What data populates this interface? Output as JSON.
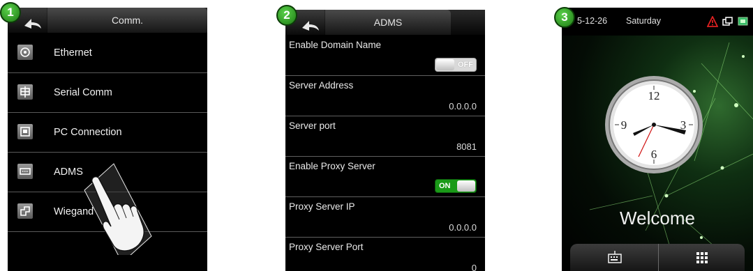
{
  "step_badges": [
    "1",
    "2",
    "3"
  ],
  "screen1": {
    "title": "Comm.",
    "items": [
      {
        "label": "Ethernet",
        "icon": "ethernet-icon"
      },
      {
        "label": "Serial Comm",
        "icon": "serial-comm-icon"
      },
      {
        "label": "PC Connection",
        "icon": "pc-connection-icon"
      },
      {
        "label": "ADMS",
        "icon": "adms-icon"
      },
      {
        "label": "Wiegand",
        "icon": "wiegand-icon"
      }
    ]
  },
  "screen2": {
    "title": "ADMS",
    "rows": [
      {
        "label": "Enable Domain Name",
        "toggle": "OFF"
      },
      {
        "label": "Server Address",
        "value": "0.0.0.0"
      },
      {
        "label": "Server port",
        "value": "8081"
      },
      {
        "label": "Enable Proxy Server",
        "toggle": "ON"
      },
      {
        "label": "Proxy Server IP",
        "value": "0.0.0.0"
      },
      {
        "label": "Proxy Server Port",
        "value": "0"
      }
    ]
  },
  "screen3": {
    "date": "5-12-26",
    "day": "Saturday",
    "welcome": "Welcome",
    "clock_numerals": [
      "12",
      "3",
      "6",
      "9"
    ],
    "status_icons": [
      "alarm-warning-icon",
      "network-icon",
      "connection-icon"
    ],
    "bottom_buttons": [
      "keyboard-icon",
      "menu-grid-icon"
    ]
  },
  "colors": {
    "badge_green": "#2e9e22",
    "toggle_on": "#1a9a18"
  }
}
